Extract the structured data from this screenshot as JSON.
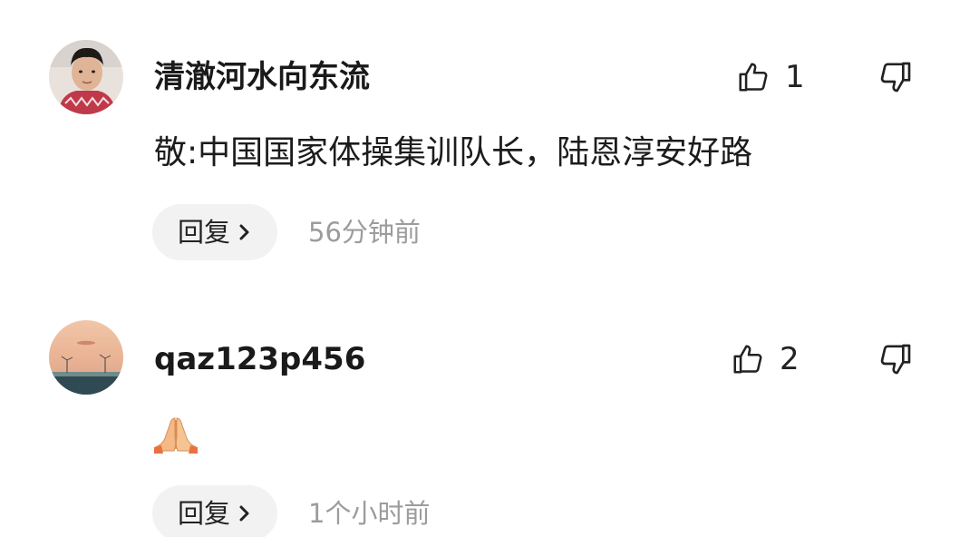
{
  "comments": [
    {
      "username": "清澈河水向东流",
      "likes": "1",
      "text": "敬:中国国家体操集训队长，陆恩淳安好路",
      "reply_label": "回复",
      "time": "56分钟前",
      "avatar": "user-photo-avatar"
    },
    {
      "username": "qaz123p456",
      "likes": "2",
      "text": "",
      "emoji": "folded-hands-icon",
      "reply_label": "回复",
      "time": "1个小时前",
      "avatar": "wind-turbine-sunset-avatar"
    }
  ],
  "icons": {
    "like": "thumbs-up-icon",
    "dislike": "thumbs-down-icon",
    "reply_chevron": "chevron-right-icon"
  },
  "colors": {
    "text_primary": "#1a1a1a",
    "text_secondary": "#9c9c9c",
    "reply_bg": "#f2f2f2"
  }
}
